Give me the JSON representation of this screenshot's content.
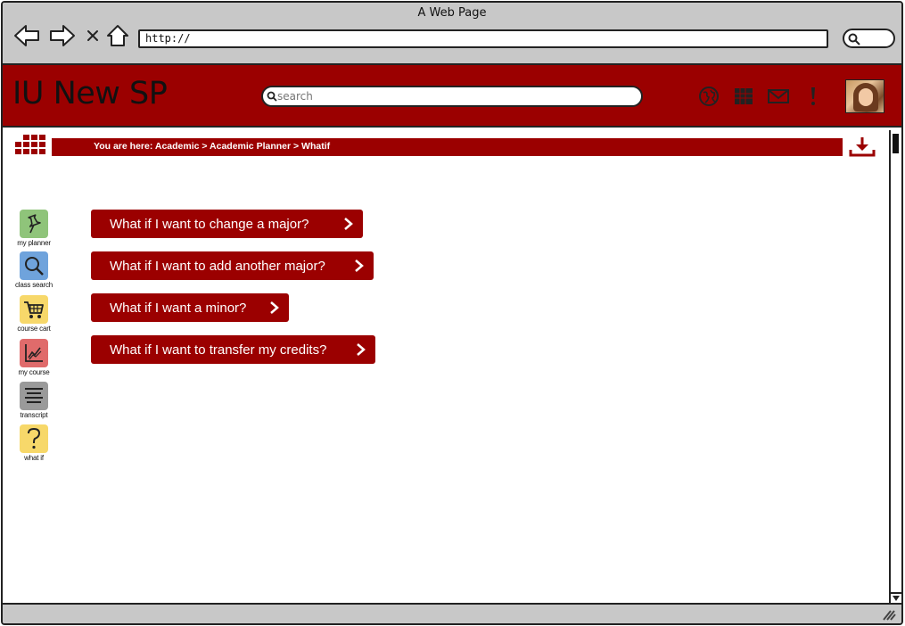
{
  "browser": {
    "window_title": "A Web Page",
    "url": "http://"
  },
  "header": {
    "app_title": "IU New SP",
    "search_placeholder": "search",
    "icons": [
      "globe-icon",
      "calendar-icon",
      "mail-icon",
      "alert-icon"
    ]
  },
  "breadcrumb": {
    "text": "You are here: Academic > Academic Planner > Whatif"
  },
  "sidebar": {
    "items": [
      {
        "label": "my planner",
        "icon": "pushpin-icon",
        "color": "#8fc47a"
      },
      {
        "label": "class search",
        "icon": "magnifier-icon",
        "color": "#6fa3dc"
      },
      {
        "label": "course cart",
        "icon": "cart-icon",
        "color": "#f7d86a"
      },
      {
        "label": "my course",
        "icon": "chart-icon",
        "color": "#e06b6b"
      },
      {
        "label": "transcript",
        "icon": "list-icon",
        "color": "#9a9a9a"
      },
      {
        "label": "what if",
        "icon": "question-icon",
        "color": "#f7d86a"
      }
    ]
  },
  "main": {
    "options": [
      {
        "label": "What if I want to change a major?"
      },
      {
        "label": "What if I want to add another major?"
      },
      {
        "label": "What if I want a minor?"
      },
      {
        "label": "What if I want to transfer my credits?"
      }
    ]
  },
  "colors": {
    "brand": "#9b0000",
    "chrome": "#c8c8c8"
  }
}
